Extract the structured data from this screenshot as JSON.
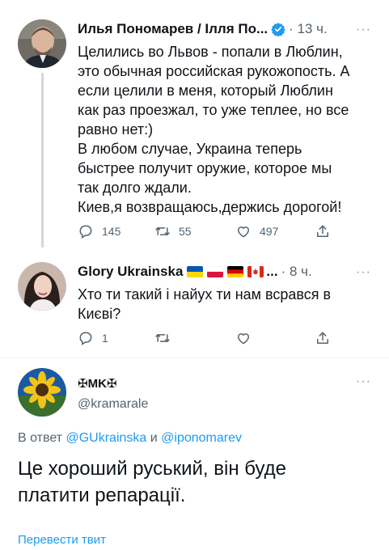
{
  "tweet1": {
    "author": "Илья Пономарев / Ілля По...",
    "time": "· 13 ч.",
    "more": "···",
    "lines": [
      "Целились во Львов - попали в Люблин,",
      "это обычная российская рукожопость. А",
      "если целили в меня, который Люблин",
      "как раз проезжал, то уже теплее, но все",
      "равно нет:)",
      "В любом случае, Украина теперь",
      "быстрее получит оружие, которое мы",
      "так долго ждали.",
      "Киев,я возвращаюсь,держись дорогой!"
    ],
    "replies": "145",
    "retweets": "55",
    "likes": "497"
  },
  "tweet2": {
    "author": "Glory Ukrainska",
    "ellipsis": "...",
    "time": "· 8 ч.",
    "more": "···",
    "lines": [
      "Хто ти такий і найух ти нам всрався в",
      "Києві?"
    ],
    "replies": "1"
  },
  "tweet3": {
    "author": "✠MK✠",
    "handle": "@kramarale",
    "more": "···",
    "reply_prefix": "В ответ",
    "reply_user1": "@GUkrainska",
    "reply_and": "и",
    "reply_user2": "@iponomarev",
    "lines": [
      "Це хороший руський, він буде",
      "платити репарації."
    ],
    "translate": "Перевести твит"
  },
  "colors": {
    "link": "#1d9bf0",
    "muted": "#536471",
    "verified": "#1d9bf0"
  }
}
